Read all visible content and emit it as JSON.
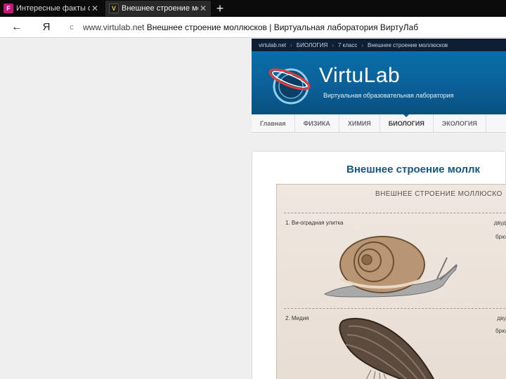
{
  "browser": {
    "tabs": [
      {
        "title": "Интересные факты о молл",
        "favicon": "F",
        "active": false
      },
      {
        "title": "Внешнее строение молл",
        "favicon": "V",
        "active": true
      }
    ],
    "new_tab_icon": "plus-icon",
    "back_icon": "arrow-left-icon",
    "yandex_icon": "Я",
    "reload_icon": "c",
    "url_domain": "www.virtulab.net",
    "url_title": "Внешнее строение моллюсков | Виртуальная лаборатория ВиртуЛаб"
  },
  "site": {
    "breadcrumb": [
      "virtulab.net",
      "БИОЛОГИЯ",
      "7 класс",
      "Внешнее строение моллюсков"
    ],
    "brand": "VirtuLab",
    "tagline": "Виртуальная образовательная лаборатория",
    "nav": [
      {
        "label": "Главная",
        "active": false
      },
      {
        "label": "ФИЗИКА",
        "active": false
      },
      {
        "label": "ХИМИЯ",
        "active": false
      },
      {
        "label": "БИОЛОГИЯ",
        "active": true
      },
      {
        "label": "ЭКОЛОГИЯ",
        "active": false
      }
    ],
    "page_heading": "Внешнее строение моллк"
  },
  "figure": {
    "title": "ВНЕШНЕЕ СТРОЕНИЕ МОЛЛЮСКО",
    "item1": "1.   Ви-оградная улитка",
    "item2": "2.   Мидия",
    "right_labels": [
      "двуд",
      "брю",
      "дву",
      "брю"
    ]
  },
  "colors": {
    "tabstrip": "#0b0b0b",
    "banner": "#0b5f96",
    "heading": "#14577f"
  }
}
